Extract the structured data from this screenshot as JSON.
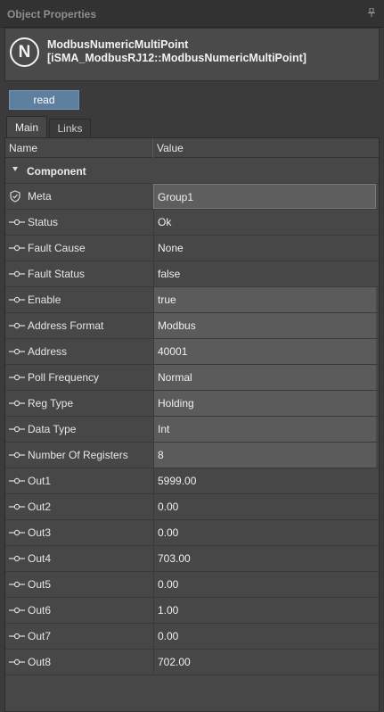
{
  "window": {
    "title": "Object Properties",
    "pin_icon": "pin-icon"
  },
  "header": {
    "logo_letter": "N",
    "object_name": "ModbusNumericMultiPoint",
    "object_type": "[iSMA_ModbusRJ12::ModbusNumericMultiPoint]"
  },
  "toolbar": {
    "read_label": "read"
  },
  "tabs": [
    {
      "label": "Main",
      "active": true
    },
    {
      "label": "Links",
      "active": false
    }
  ],
  "table": {
    "col_name": "Name",
    "col_value": "Value",
    "group_label": "Component",
    "rows": [
      {
        "name": "Meta",
        "value": "Group1",
        "icon": "shield-check-icon",
        "editable": true
      },
      {
        "name": "Status",
        "value": "Ok",
        "icon": "slot-icon",
        "editable": false
      },
      {
        "name": "Fault Cause",
        "value": "None",
        "icon": "slot-icon",
        "editable": false
      },
      {
        "name": "Fault Status",
        "value": "false",
        "icon": "slot-icon",
        "editable": false
      },
      {
        "name": "Enable",
        "value": "true",
        "icon": "slot-icon",
        "editable": true
      },
      {
        "name": "Address Format",
        "value": "Modbus",
        "icon": "slot-icon",
        "editable": true
      },
      {
        "name": "Address",
        "value": "40001",
        "icon": "slot-icon",
        "editable": true
      },
      {
        "name": "Poll Frequency",
        "value": "Normal",
        "icon": "slot-icon",
        "editable": true
      },
      {
        "name": "Reg Type",
        "value": "Holding",
        "icon": "slot-icon",
        "editable": true
      },
      {
        "name": "Data Type",
        "value": "Int",
        "icon": "slot-icon",
        "editable": true
      },
      {
        "name": "Number Of Registers",
        "value": "8",
        "icon": "slot-icon",
        "editable": true
      },
      {
        "name": "Out1",
        "value": "5999.00",
        "icon": "slot-icon",
        "editable": false
      },
      {
        "name": "Out2",
        "value": "0.00",
        "icon": "slot-icon",
        "editable": false
      },
      {
        "name": "Out3",
        "value": "0.00",
        "icon": "slot-icon",
        "editable": false
      },
      {
        "name": "Out4",
        "value": "703.00",
        "icon": "slot-icon",
        "editable": false
      },
      {
        "name": "Out5",
        "value": "0.00",
        "icon": "slot-icon",
        "editable": false
      },
      {
        "name": "Out6",
        "value": "1.00",
        "icon": "slot-icon",
        "editable": false
      },
      {
        "name": "Out7",
        "value": "0.00",
        "icon": "slot-icon",
        "editable": false
      },
      {
        "name": "Out8",
        "value": "702.00",
        "icon": "slot-icon",
        "editable": false
      }
    ]
  },
  "colors": {
    "read_button": "#5e7f9f",
    "editable_value_bg": "#5b5b5b",
    "readonly_value_bg": "#474747"
  }
}
